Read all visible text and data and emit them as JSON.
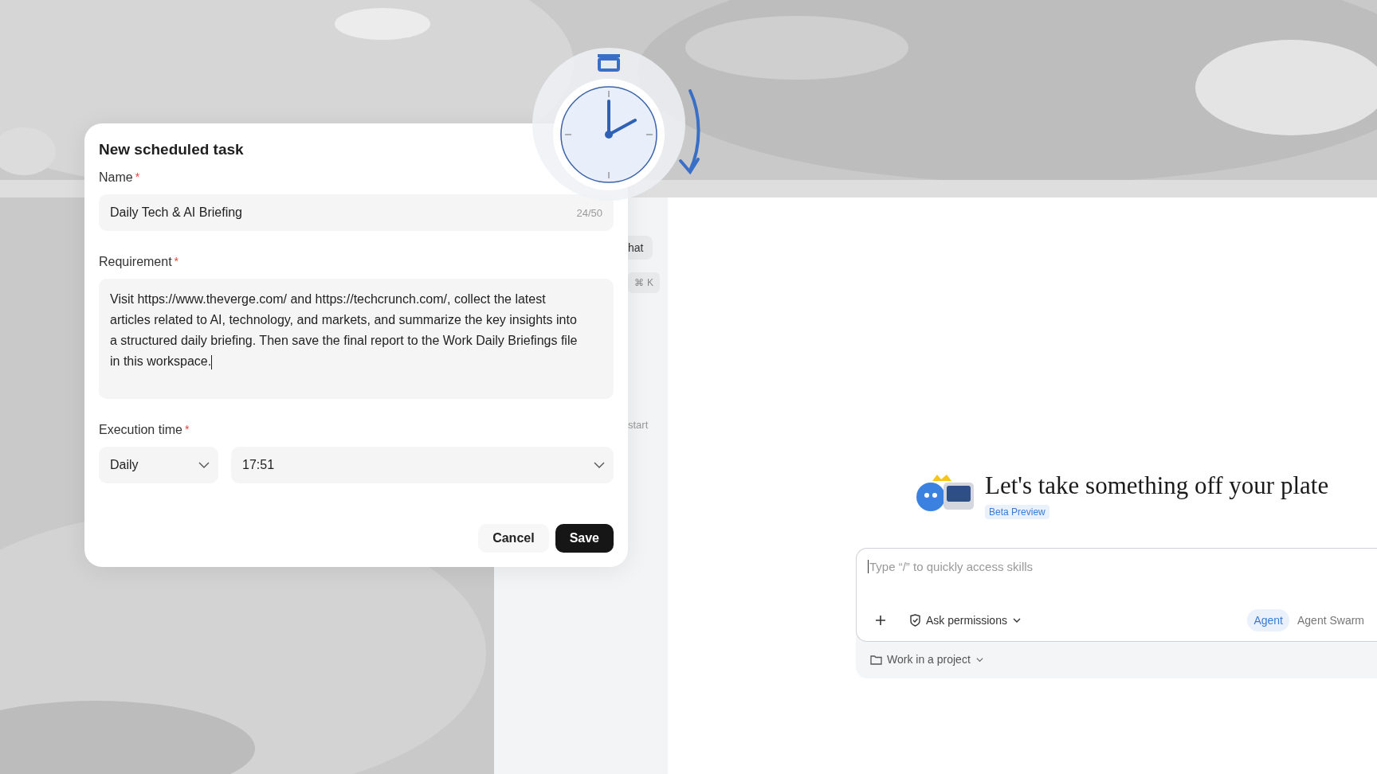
{
  "dialog": {
    "title": "New scheduled task",
    "name_field": {
      "label": "Name",
      "required_mark": "*",
      "value": "Daily Tech & AI Briefing",
      "counter": "24/50"
    },
    "requirement_field": {
      "label": "Requirement",
      "required_mark": "*",
      "value": "Visit https://www.theverge.com/ and https://techcrunch.com/, collect the latest articles related to AI, technology, and markets, and summarize the key insights into a structured daily briefing. Then save the final report to the Work Daily Briefings file in this workspace."
    },
    "execution_field": {
      "label": "Execution time",
      "required_mark": "*",
      "frequency": "Daily",
      "time": "17:51"
    },
    "buttons": [
      {
        "label": "Cancel",
        "kind": "secondary"
      },
      {
        "label": "Save",
        "kind": "primary"
      }
    ]
  },
  "sidebar": {
    "items": [
      {
        "label": "hat",
        "kind": "tab"
      },
      {
        "keys": [
          "⌘",
          "K"
        ],
        "kind": "shortcut"
      },
      {
        "label": "start",
        "kind": "text"
      }
    ]
  },
  "hero": {
    "title": "Let's take something off your plate",
    "badge": "Beta Preview"
  },
  "composer": {
    "placeholder": "Type “/” to quickly access skills",
    "permissions": "Ask permissions",
    "modes": [
      {
        "label": "Agent",
        "selected": true
      },
      {
        "label": "Agent Swarm",
        "selected": false
      }
    ],
    "project": "Work in a project"
  }
}
